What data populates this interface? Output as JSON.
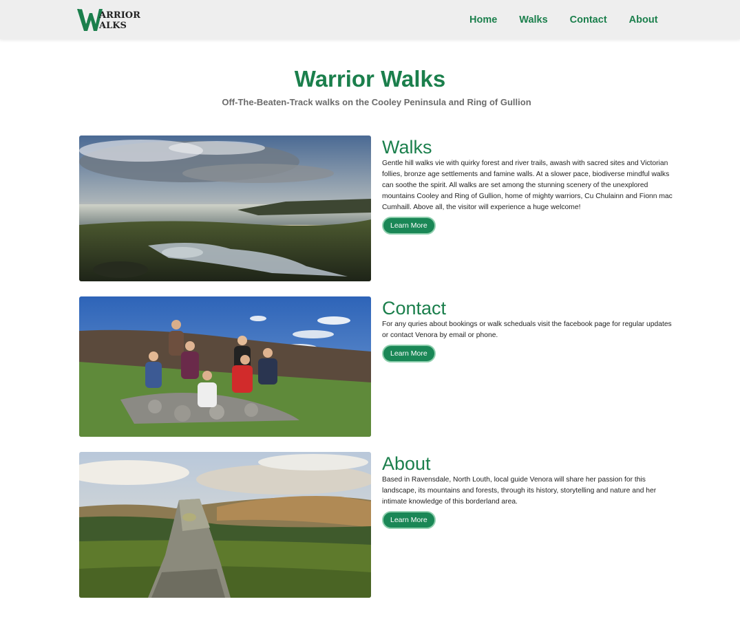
{
  "header": {
    "logo_text_top": "ARRIOR",
    "logo_text_bottom": "ALKS",
    "nav": [
      {
        "label": "Home"
      },
      {
        "label": "Walks"
      },
      {
        "label": "Contact"
      },
      {
        "label": "About"
      }
    ]
  },
  "hero": {
    "title": "Warrior Walks",
    "subtitle": "Off-The-Beaten-Track walks on the Cooley Peninsula and Ring of Gullion"
  },
  "sections": [
    {
      "heading": "Walks",
      "text": "Gentle hill walks vie with quirky forest and river trails, awash with sacred sites and Victorian follies, bronze age settlements and famine walls. At a slower pace, biodiverse mindful walks can soothe the spirit. All walks are set among the stunning scenery of the unexplored mountains Cooley and Ring of Gullion, home of mighty warriors, Cu Chulainn and Fionn mac Cumhaill. Above all, the visitor will experience a huge welcome!",
      "button": "Learn More"
    },
    {
      "heading": "Contact",
      "text": "For any quries about bookings or walk scheduals visit the facebook page for regular updates or contact Venora by email or phone.",
      "button": "Learn More"
    },
    {
      "heading": "About",
      "text": "Based in Ravensdale, North Louth, local guide Venora will share her passion for this landscape, its mountains and forests, through its history, storytelling and nature and her intimate knowledge of this borderland area.",
      "button": "Learn More"
    }
  ],
  "colors": {
    "brand_green": "#1b7f4c",
    "button_green": "#1a8756",
    "header_bg": "#eeeeee"
  }
}
